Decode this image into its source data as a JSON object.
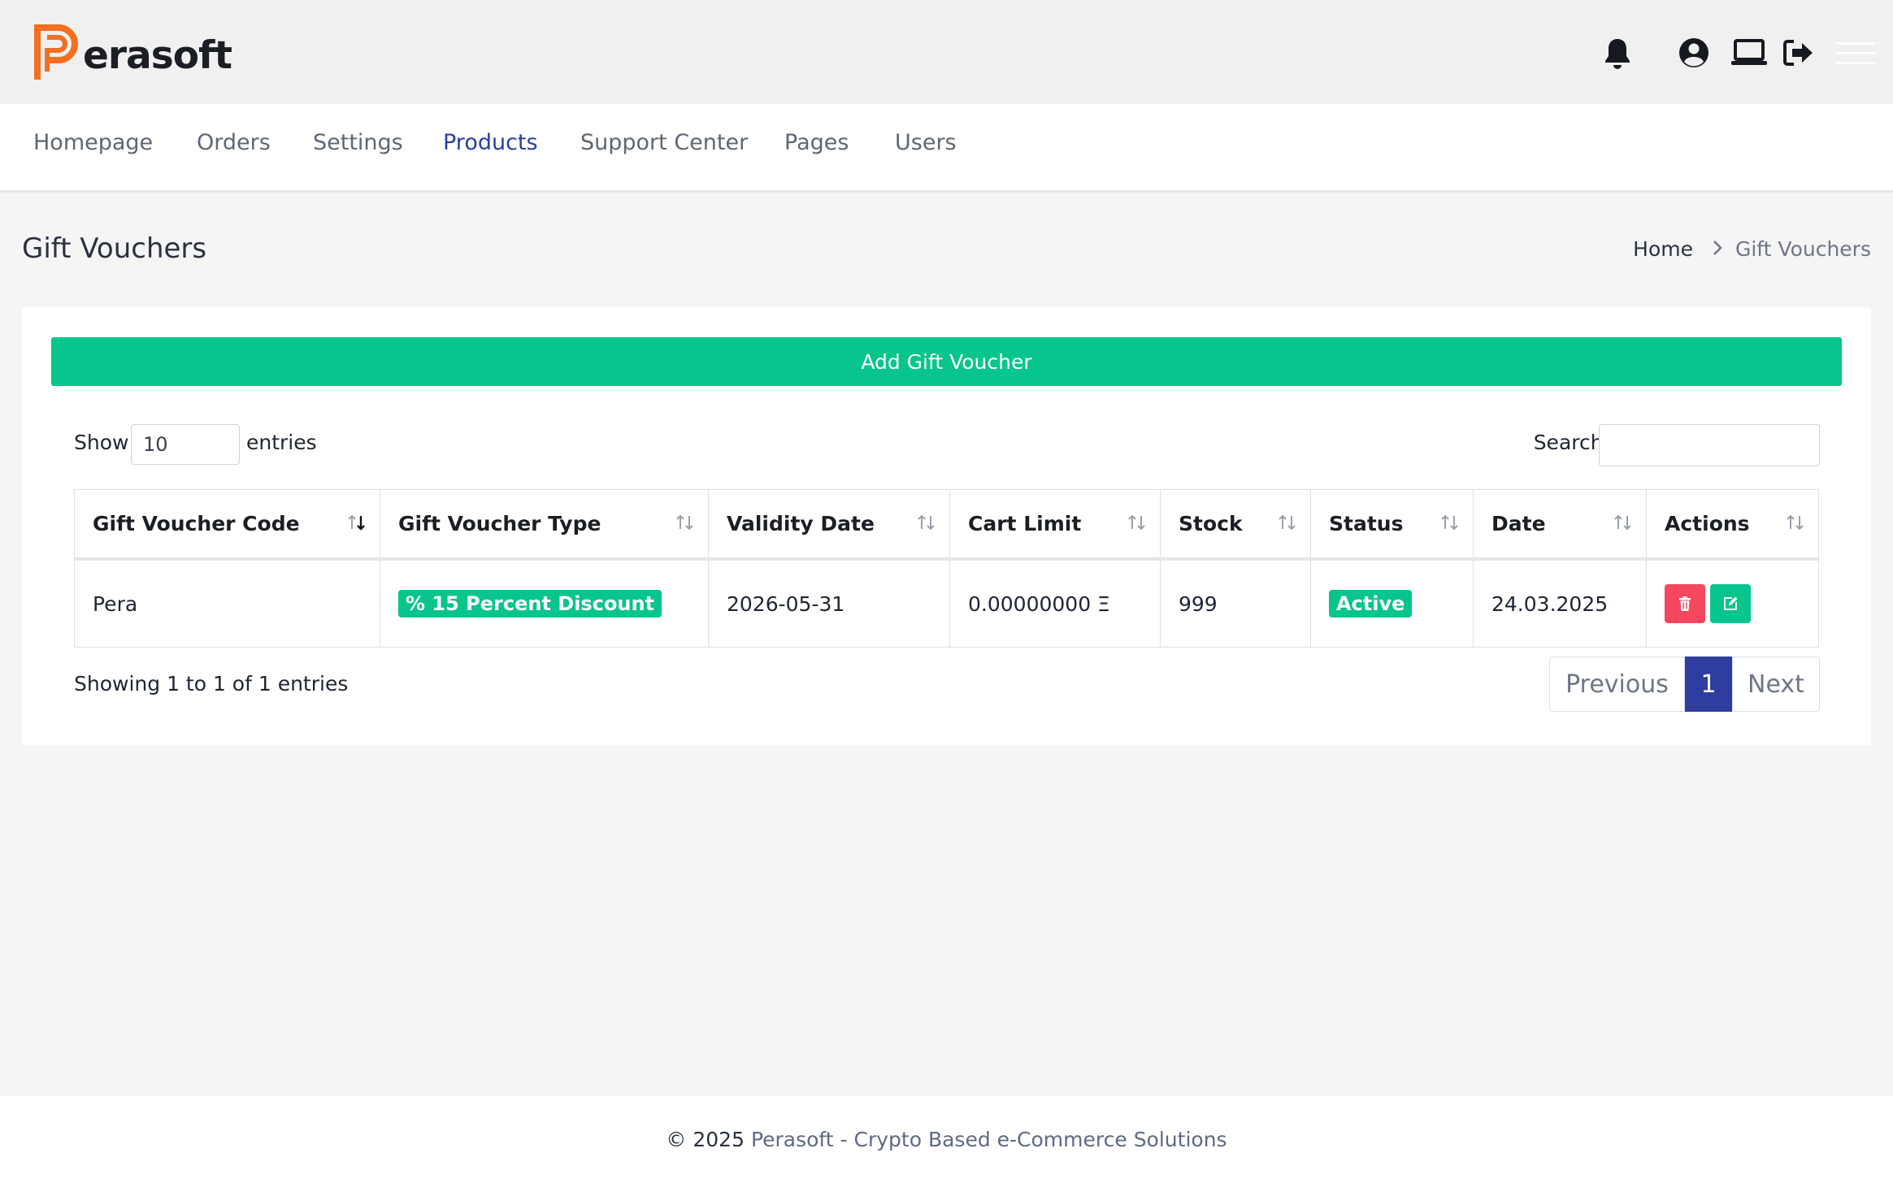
{
  "brand": {
    "name": "erasoft"
  },
  "top_icons": [
    "bell-icon",
    "user-circle-icon",
    "laptop-icon",
    "sign-out-icon",
    "hamburger-menu-icon"
  ],
  "nav": {
    "items": [
      {
        "label": "Homepage"
      },
      {
        "label": "Orders"
      },
      {
        "label": "Settings"
      },
      {
        "label": "Products",
        "active": true
      },
      {
        "label": "Support Center"
      },
      {
        "label": "Pages"
      },
      {
        "label": "Users"
      }
    ]
  },
  "page": {
    "title": "Gift Vouchers"
  },
  "breadcrumb": {
    "home": "Home",
    "current": "Gift Vouchers"
  },
  "card": {
    "add_button": "Add Gift Voucher",
    "length": {
      "show": "Show",
      "value": "10",
      "entries": "entries"
    },
    "search": {
      "label": "Search:",
      "value": ""
    }
  },
  "table": {
    "columns": [
      "Gift Voucher Code",
      "Gift Voucher Type",
      "Validity Date",
      "Cart Limit",
      "Stock",
      "Status",
      "Date",
      "Actions"
    ],
    "rows": [
      {
        "code": "Pera",
        "type": "% 15 Percent Discount",
        "validity": "2026-05-31",
        "cart_limit": "0.00000000 Ξ",
        "stock": "999",
        "status": "Active",
        "date": "24.03.2025"
      }
    ]
  },
  "info": "Showing 1 to 1 of 1 entries",
  "pagination": {
    "previous": "Previous",
    "current": "1",
    "next": "Next"
  },
  "footer": {
    "copyright": "© 2025",
    "text": "Perasoft - Crypto Based e-Commerce Solutions"
  },
  "colors": {
    "accent_green": "#07c58c",
    "active_nav": "#2a3fa0",
    "pagination_active": "#2f3e9e",
    "delete_red": "#f5475d",
    "logo_orange": "#f36f21"
  }
}
